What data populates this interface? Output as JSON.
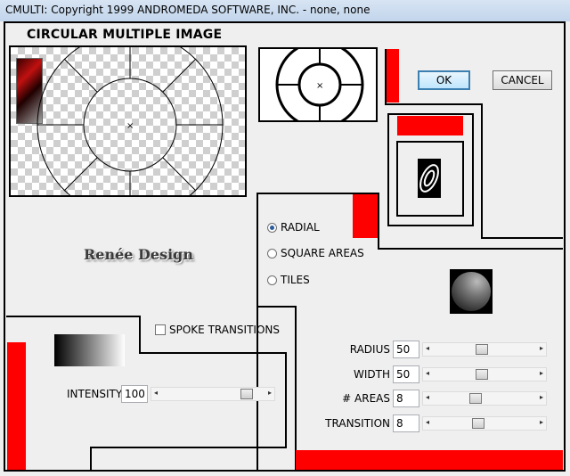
{
  "window": {
    "title": "CMULTI: Copyright 1999 ANDROMEDA SOFTWARE, INC. - none, none"
  },
  "heading": "CIRCULAR MULTIPLE IMAGE",
  "buttons": {
    "ok": "OK",
    "cancel": "CANCEL"
  },
  "mode": {
    "options": [
      "RADIAL",
      "SQUARE AREAS",
      "TILES"
    ],
    "selected": "RADIAL"
  },
  "spoke_transitions": {
    "label": "SPOKE TRANSITIONS",
    "checked": false
  },
  "intensity": {
    "label": "INTENSITY",
    "value": "100",
    "slider_fraction": 0.88
  },
  "params": [
    {
      "label": "RADIUS",
      "value": "50",
      "slider_fraction": 0.47
    },
    {
      "label": "WIDTH",
      "value": "50",
      "slider_fraction": 0.47
    },
    {
      "label": "# AREAS",
      "value": "8",
      "slider_fraction": 0.4
    },
    {
      "label": "TRANSITION",
      "value": "8",
      "slider_fraction": 0.43
    }
  ],
  "logo_text": "Renée Design",
  "colors": {
    "accent_red": "#ff0000",
    "ok_border": "#3c7fb1"
  },
  "icons": {
    "slider_left": "◂",
    "slider_right": "▸"
  }
}
